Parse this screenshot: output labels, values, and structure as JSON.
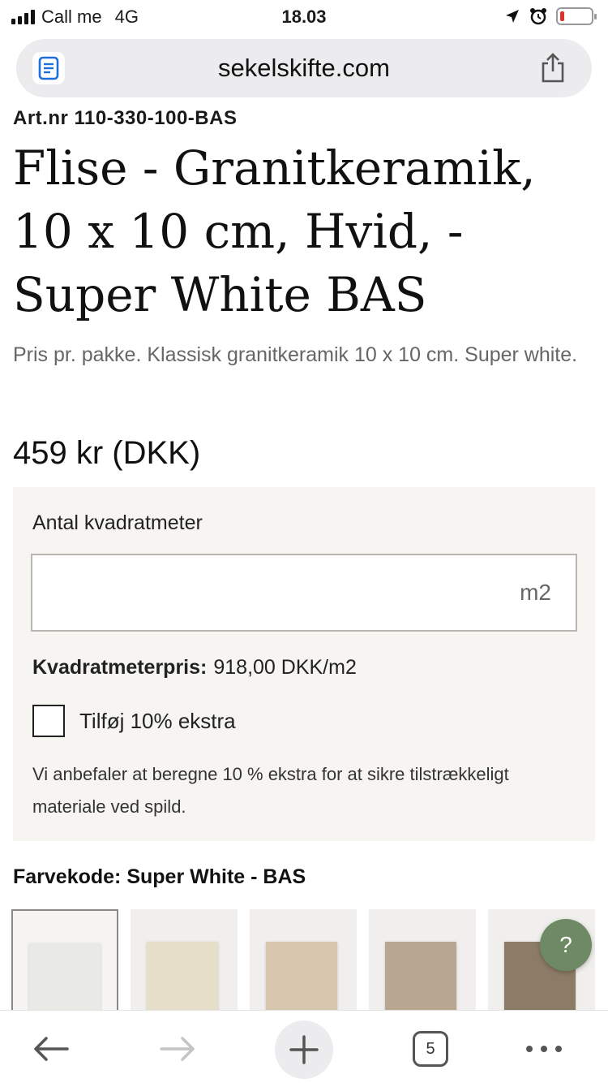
{
  "status_bar": {
    "carrier": "Call me",
    "network": "4G",
    "time": "18.03",
    "battery_level": 0.15,
    "battery_color": "#e0302a"
  },
  "browser": {
    "url": "sekelskifte.com",
    "reader_icon": "reader-icon",
    "share_icon": "share-icon",
    "tab_count": "5"
  },
  "product": {
    "art_nr": "Art.nr 110-330-100-BAS",
    "title": "Flise - Granitkeramik, 10 x 10 cm, Hvid, - Super White BAS",
    "description": "Pris pr. pakke. Klassisk granitkeramik 10 x 10 cm. Super white.",
    "price": "459 kr (DKK)"
  },
  "calculator": {
    "label": "Antal kvadratmeter",
    "input_value": "",
    "unit": "m2",
    "sqm_price_label": "Kvadratmeterpris:",
    "sqm_price_value": "918,00 DKK/m2",
    "extra_label": "Tilføj 10% ekstra",
    "extra_checked": false,
    "note": "Vi anbefaler at beregne 10 % ekstra for at sikre tilstrækkeligt materiale ved spild."
  },
  "color": {
    "label": "Farvekode: Super White - BAS",
    "swatches": [
      {
        "color": "#e9e9e6",
        "selected": true
      },
      {
        "color": "#e6dec8",
        "selected": false
      },
      {
        "color": "#d6c7ae",
        "selected": false
      },
      {
        "color": "#b8a690",
        "selected": false
      },
      {
        "color": "#8c7b66",
        "selected": false
      }
    ]
  },
  "help_button": "?",
  "toolbar": {
    "back_icon": "arrow-left-icon",
    "forward_icon": "arrow-right-icon",
    "new_tab_icon": "plus-icon",
    "more_icon": "more-icon"
  }
}
